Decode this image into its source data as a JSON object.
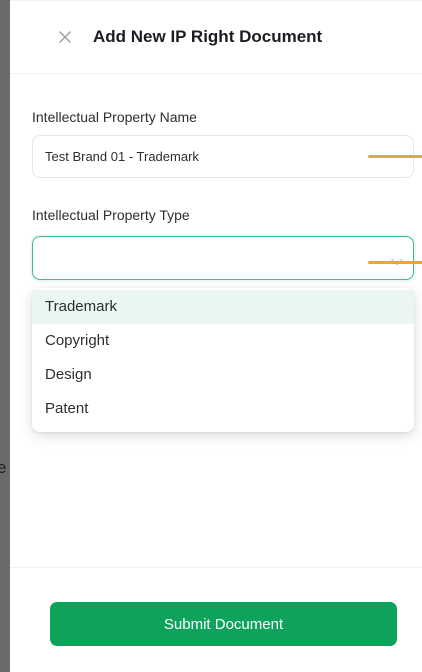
{
  "drawer": {
    "title": "Add New IP Right Document",
    "close_icon": "close-icon"
  },
  "backdrop": {
    "peek_text": "e"
  },
  "form": {
    "name_label": "Intellectual Property Name",
    "name_value": "Test Brand 01 - Trademark",
    "type_label": "Intellectual Property Type",
    "type_value": "",
    "type_options": [
      "Trademark",
      "Copyright",
      "Design",
      "Patent"
    ],
    "highlighted_option": "Trademark"
  },
  "footer": {
    "submit_label": "Submit Document"
  },
  "colors": {
    "primary": "#0ea35a",
    "focus_border": "#3fba8a",
    "option_highlight": "#e9f7f0",
    "annotation_mark": "#f2a23a"
  }
}
